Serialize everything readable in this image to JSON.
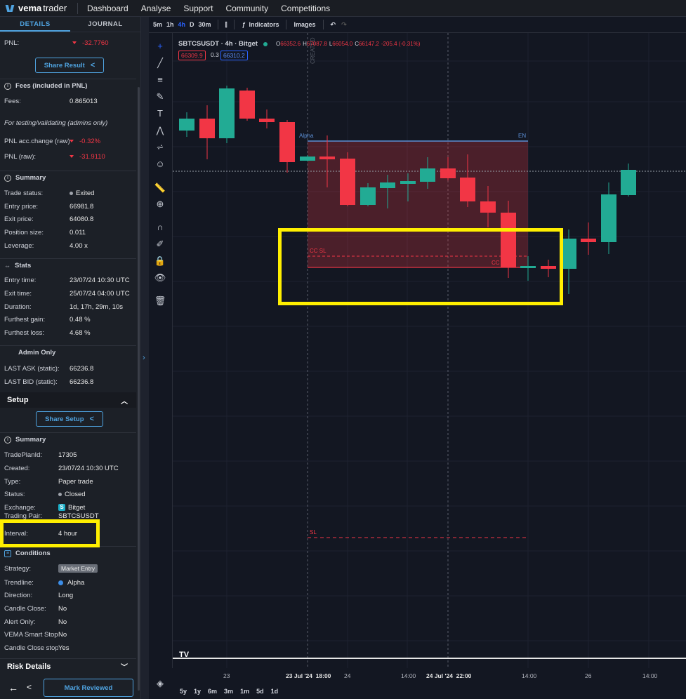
{
  "app": {
    "brand_bold": "vema",
    "brand_thin": "trader"
  },
  "nav": [
    "Dashboard",
    "Analyse",
    "Support",
    "Community",
    "Competitions"
  ],
  "tabs": {
    "details": "DETAILS",
    "journal": "JOURNAL"
  },
  "details": {
    "pnl_label": "PNL:",
    "pnl_value": "-32.7760",
    "share_result": "Share Result",
    "fees_header": "Fees (included in PNL)",
    "fees_label": "Fees:",
    "fees_value": "0.865013",
    "testing_note": "For testing/validating (admins only)",
    "pnl_acc_label": "PNL acc.change (raw):",
    "pnl_acc_value": "-0.32%",
    "pnl_raw_label": "PNL (raw):",
    "pnl_raw_value": "-31.9110",
    "summary_header": "Summary",
    "trade_status_label": "Trade status:",
    "trade_status_value": "Exited",
    "entry_price_label": "Entry price:",
    "entry_price_value": "66981.8",
    "exit_price_label": "Exit price:",
    "exit_price_value": "64080.8",
    "position_size_label": "Position size:",
    "position_size_value": "0.011",
    "leverage_label": "Leverage:",
    "leverage_value": "4.00 x",
    "stats_header": "Stats",
    "entry_time_label": "Entry time:",
    "entry_time_value": "23/07/24 10:30 UTC",
    "exit_time_label": "Exit time:",
    "exit_time_value": "25/07/24 04:00 UTC",
    "duration_label": "Duration:",
    "duration_value": "1d, 17h, 29m, 10s",
    "furthest_gain_label": "Furthest gain:",
    "furthest_gain_value": "0.48 %",
    "furthest_loss_label": "Furthest loss:",
    "furthest_loss_value": "4.68 %",
    "admin_header": "Admin Only",
    "last_ask_label": "LAST ASK (static):",
    "last_ask_value": "66236.8",
    "last_bid_label": "LAST BID (static):",
    "last_bid_value": "66236.8"
  },
  "setup": {
    "header": "Setup",
    "share_setup": "Share Setup",
    "summary_header": "Summary",
    "tradeplan_label": "TradePlanId:",
    "tradeplan_value": "17305",
    "created_label": "Created:",
    "created_value": "23/07/24 10:30 UTC",
    "type_label": "Type:",
    "type_value": "Paper trade",
    "status_label": "Status:",
    "status_value": "Closed",
    "exchange_label": "Exchange:",
    "exchange_value": "Bitget",
    "pair_label": "Trading Pair:",
    "pair_value": "SBTCSUSDT",
    "interval_label": "Interval:",
    "interval_value": "4 hour",
    "conditions_header": "Conditions",
    "strategy_label": "Strategy:",
    "strategy_value": "Market Entry",
    "trendline_label": "Trendline:",
    "trendline_value": "Alpha",
    "direction_label": "Direction:",
    "direction_value": "Long",
    "candle_close_label": "Candle Close:",
    "candle_close_value": "No",
    "alert_only_label": "Alert Only:",
    "alert_only_value": "No",
    "vema_stop_label": "VEMA Smart Stop:",
    "vema_stop_value": "No",
    "candle_close_stop_label": "Candle Close stop:",
    "candle_close_stop_value": "Yes",
    "risk_header": "Risk Details",
    "mark_reviewed": "Mark Reviewed"
  },
  "toolbar": {
    "timeframes": [
      "5m",
      "1h",
      "4h",
      "D",
      "30m"
    ],
    "active_timeframe": "4h",
    "indicators": "Indicators",
    "images": "Images"
  },
  "chart_legend": {
    "symbol": "SBTCSUSDT · 4h · Bitget",
    "o_label": "O",
    "o": "66352.6",
    "h_label": "H",
    "h": "67087.8",
    "l_label": "L",
    "l": "66054.0",
    "c_label": "C",
    "c": "66147.2",
    "change": "-205.4 (-0.31%)",
    "bid": "66309.9",
    "spread": "0.3",
    "ask": "66310.2"
  },
  "chart_data": {
    "type": "candlestick",
    "x_ticks": [
      "23",
      "23 Jul '24  18:00",
      "24",
      "14:00",
      "24 Jul '24  22:00",
      "14:00",
      "26",
      "14:00"
    ],
    "annotations": [
      "Alpha",
      "EN",
      "CC SL",
      "CC (Exit)",
      "SL",
      "CREATED"
    ],
    "colors": {
      "up": "#22ab94",
      "down": "#f23645",
      "highlight": "#ffef00"
    }
  },
  "bottom_ranges": [
    "5y",
    "1y",
    "6m",
    "3m",
    "1m",
    "5d",
    "1d"
  ]
}
